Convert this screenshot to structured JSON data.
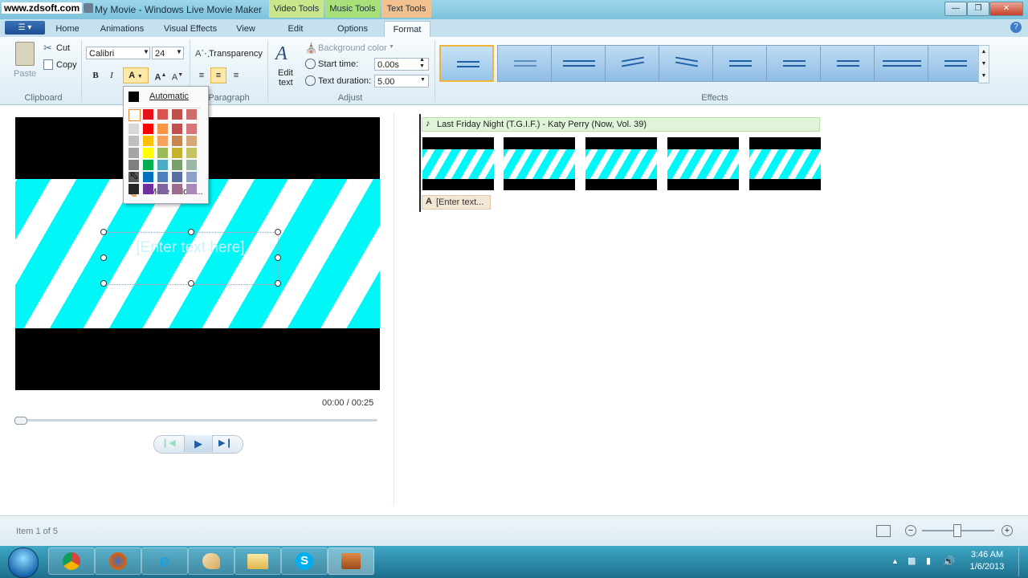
{
  "watermark": "www.zdsoft.com",
  "window": {
    "title": "My Movie - Windows Live Movie Maker"
  },
  "context_tabs": [
    {
      "label": "Video Tools",
      "color": "#cbe58a"
    },
    {
      "label": "Music Tools",
      "color": "#a8e07a"
    },
    {
      "label": "Text Tools",
      "color": "#f3c08f"
    }
  ],
  "tabs": [
    "Home",
    "Animations",
    "Visual Effects",
    "View",
    "Edit",
    "Options",
    "Format"
  ],
  "active_tab": "Format",
  "ribbon": {
    "clipboard": {
      "paste": "Paste",
      "cut": "Cut",
      "copy": "Copy",
      "group": "Clipboard"
    },
    "font": {
      "family": "Calibri",
      "size": "24",
      "transparency": "Transparency",
      "bold": "B",
      "italic": "I",
      "grow": "A",
      "shrink": "A",
      "color": "A"
    },
    "paragraph": {
      "group": "Paragraph"
    },
    "adjust": {
      "edit_text_line1": "Edit",
      "edit_text_line2": "text",
      "background_color": "Background color",
      "start_time_label": "Start time:",
      "start_time_value": "0.00s",
      "text_duration_label": "Text duration:",
      "text_duration_value": "5.00",
      "group": "Adjust"
    },
    "effects": {
      "group": "Effects"
    }
  },
  "color_picker": {
    "automatic": "Automatic",
    "more_colors": "More colors...",
    "row0": [
      "#ffffff",
      "#e8111b",
      "#d9534f",
      "#c0504d",
      "#d06c6c"
    ],
    "columns": [
      [
        "#d8d8d8",
        "#bfbfbf",
        "#a5a5a5",
        "#7f7f7f",
        "#595959",
        "#262626"
      ],
      [
        "#ff0000",
        "#ffc000",
        "#ffff00",
        "#00b050",
        "#0070c0",
        "#7030a0"
      ],
      [
        "#f79646",
        "#f5a35e",
        "#9bbb59",
        "#4bacc6",
        "#4f81bd",
        "#8064a2"
      ],
      [
        "#c0504d",
        "#c7864f",
        "#c5b32e",
        "#77a06b",
        "#5a6fa0",
        "#9d6c8d"
      ],
      [
        "#d6747a",
        "#d6a779",
        "#c4c466",
        "#9ab8a3",
        "#8da0c8",
        "#a78ab5"
      ]
    ]
  },
  "preview": {
    "text": "[Enter text here]",
    "time": "00:00 / 00:25"
  },
  "storyboard": {
    "music": "Last Friday Night (T.G.I.F.) - Katy Perry (Now, Vol. 39)",
    "caption": "[Enter text...",
    "clip_count": 5
  },
  "status": {
    "item": "Item 1 of 5"
  },
  "clock": {
    "time": "3:46 AM",
    "date": "1/6/2013"
  },
  "taskbar_apps": [
    "start-orb",
    "chrome",
    "firefox",
    "internet-explorer",
    "paint",
    "folder",
    "skype",
    "movie-maker"
  ]
}
